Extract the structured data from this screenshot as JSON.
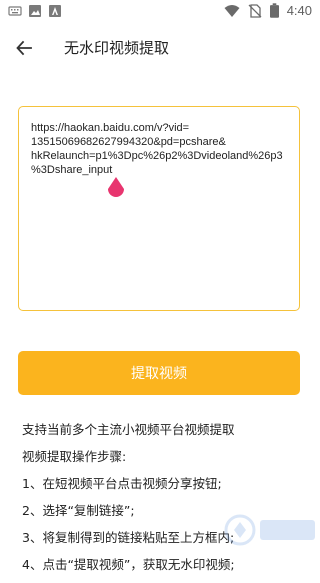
{
  "status_bar": {
    "time": "4:40",
    "left_icons": [
      "keyboard-icon",
      "image-icon",
      "font-icon"
    ],
    "right_icons": [
      "wifi-icon",
      "no-sim-icon",
      "battery-icon"
    ]
  },
  "app_bar": {
    "title": "无水印视频提取",
    "back_icon": "arrow-back-icon"
  },
  "url_input": {
    "value": "https://haokan.baidu.com/v?vid=\n13515069682627994320&pd=pcshare&\nhkRelaunch=p1%3Dpc%26p2%3Dvideoland%26p3\n%3Dshare_input",
    "border_color": "#f5c23b"
  },
  "extract_button": {
    "label": "提取视频",
    "color": "#fbb41e"
  },
  "instructions": {
    "lines": [
      "支持当前多个主流小视频平台视频提取",
      "视频提取操作步骤:",
      "1、在短视频平台点击视频分享按钮;",
      "2、选择“复制链接”;",
      "3、将复制得到的链接粘贴至上方框内;",
      "4、点击“提取视频”，获取无水印视频;"
    ]
  }
}
